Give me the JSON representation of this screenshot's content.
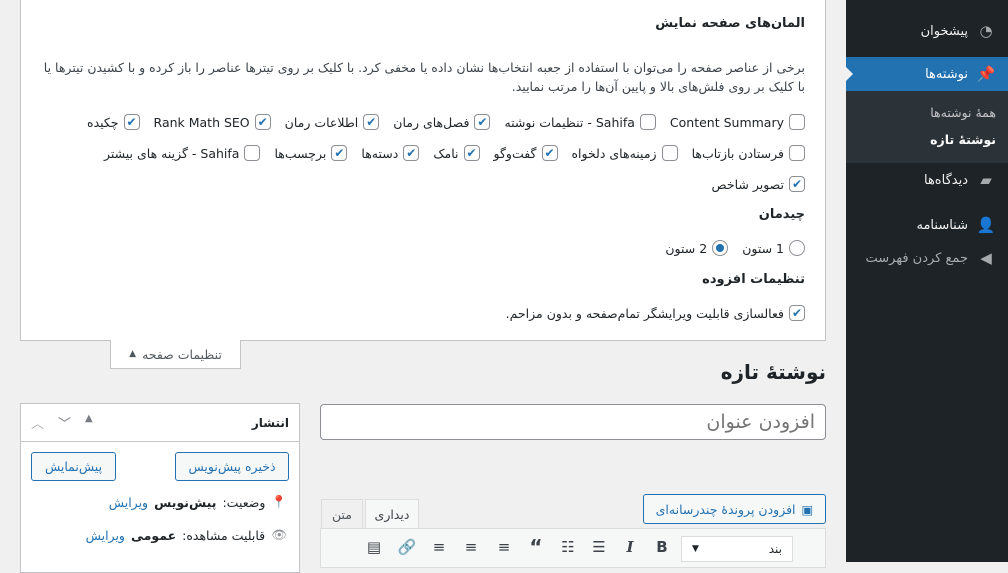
{
  "sidebar": {
    "items": [
      {
        "label": "پیشخوان",
        "icon": "dashboard-icon"
      },
      {
        "label": "نوشته‌ها",
        "icon": "pin-icon",
        "active": true
      },
      {
        "label": "دیدگاه‌ها",
        "icon": "comment-icon"
      },
      {
        "label": "شناسنامه",
        "icon": "user-icon"
      },
      {
        "label": "جمع کردن فهرست",
        "icon": "collapse-icon"
      }
    ],
    "submenu": [
      "همهٔ نوشته‌ها",
      "نوشتهٔ تازه"
    ]
  },
  "screen_options": {
    "heading": "المان‌های صفحه نمایش",
    "description": "برخی از عناصر صفحه را می‌توان با استفاده از جعبه انتخاب‌ها نشان داده یا مخفی کرد. با کلیک بر روی تیترها عناصر را باز کرده و با کشیدن تیترها یا با کلیک بر روی فلش‌های بالا و پایین آن‌ها را مرتب نمایید.",
    "rows": [
      [
        {
          "label": "Content Summary",
          "checked": false
        },
        {
          "label": "Sahifa - تنظیمات نوشته",
          "checked": false
        },
        {
          "label": "فصل‌های رمان",
          "checked": true
        },
        {
          "label": "اطلاعات رمان",
          "checked": true
        },
        {
          "label": "Rank Math SEO",
          "checked": true
        },
        {
          "label": "چکیده",
          "checked": true
        }
      ],
      [
        {
          "label": "فرستادن بازتاب‌ها",
          "checked": false
        },
        {
          "label": "زمینه‌های دلخواه",
          "checked": false
        },
        {
          "label": "گفت‌وگو",
          "checked": true
        },
        {
          "label": "نامک",
          "checked": true
        },
        {
          "label": "دسته‌ها",
          "checked": true
        },
        {
          "label": "برچسب‌ها",
          "checked": true
        },
        {
          "label": "Sahifa - گزینه های بیشتر",
          "checked": false
        }
      ],
      [
        {
          "label": "تصویر شاخص",
          "checked": true
        }
      ]
    ],
    "layout_heading": "چیدمان",
    "layout_options": [
      {
        "label": "1 ستون",
        "selected": false
      },
      {
        "label": "2 ستون",
        "selected": true
      }
    ],
    "extra_heading": "تنظیمات افزوده",
    "extra_option": {
      "label": "فعالسازی قابلیت ویرایشگر تمام‌صفحه و بدون مزاحم.",
      "checked": true
    },
    "tab_label": "تنظیمات صفحه"
  },
  "page_title": "نوشتهٔ تازه",
  "title_placeholder": "افزودن عنوان",
  "publish": {
    "title": "انتشار",
    "save_draft": "ذخیره پیش‌نویس",
    "preview": "پیش‌نمایش",
    "status_label": "وضعیت:",
    "status_value": "پیش‌نویس",
    "visibility_label": "قابلیت مشاهده:",
    "visibility_value": "عمومی",
    "edit": "ویرایش"
  },
  "editor": {
    "add_media": "افزودن پروندهٔ چندرسانه‌ای",
    "tab_visual": "دیداری",
    "tab_text": "متن",
    "format": "بند"
  },
  "colors": {
    "accent": "#2271b1",
    "sidebar": "#1d2327"
  }
}
